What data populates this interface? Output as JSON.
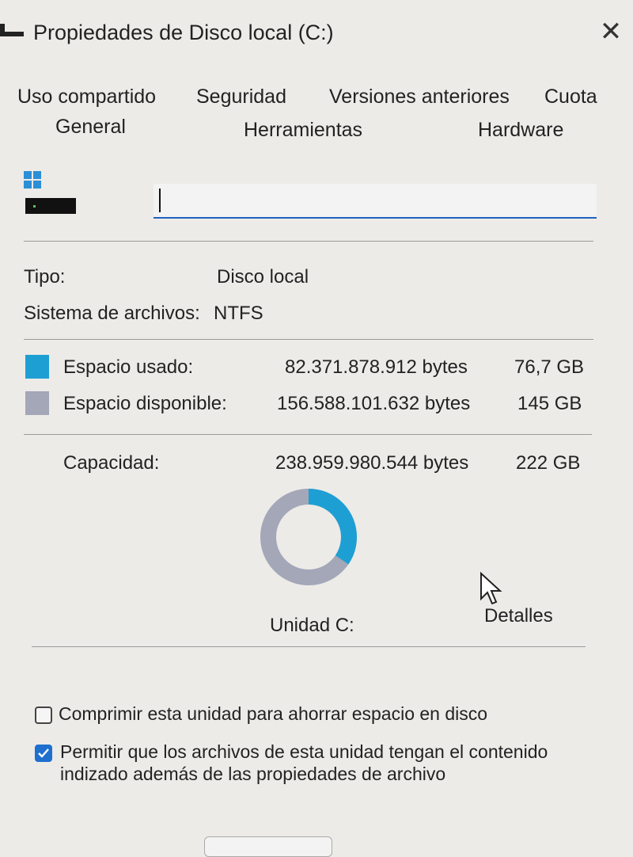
{
  "window": {
    "title": "Propiedades de Disco local (C:)",
    "close_glyph": "✕",
    "icon": "drive-title-icon"
  },
  "tabs_row1": [
    "Uso compartido",
    "Seguridad",
    "Versiones anteriores",
    "Cuota"
  ],
  "tabs_row2": [
    "General",
    "Herramientas",
    "Hardware"
  ],
  "general": {
    "drive_icon": "windows-drive-icon",
    "name_value": "",
    "type_label": "Tipo:",
    "type_value": "Disco local",
    "fs_label": "Sistema de archivos:",
    "fs_value": "NTFS",
    "used": {
      "label": "Espacio usado:",
      "bytes": "82.371.878.912 bytes",
      "size": "76,7 GB",
      "color": "#1e9fd4"
    },
    "free": {
      "label": "Espacio disponible:",
      "bytes": "156.588.101.632 bytes",
      "size": "145 GB",
      "color": "#a3a7b8"
    },
    "capacity": {
      "label": "Capacidad:",
      "bytes": "238.959.980.544 bytes",
      "size": "222 GB"
    },
    "used_fraction": 0.345,
    "drive_label": "Unidad C:",
    "details_button": "Detalles"
  },
  "options": {
    "compress": {
      "label": "Comprimir esta unidad para ahorrar espacio en disco",
      "checked": false
    },
    "index": {
      "label_line1": "Permitir que los archivos de esta unidad tengan el contenido",
      "label_line2": "indizado además de las propiedades de archivo",
      "checked": true
    }
  },
  "colors": {
    "accent": "#1f6fcf",
    "background": "#ecebe8"
  }
}
